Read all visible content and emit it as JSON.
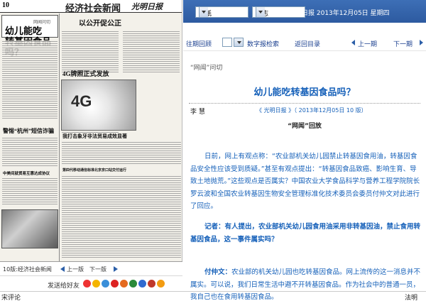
{
  "newspaper": {
    "page_number": "10",
    "section_title": "经济社会新闻",
    "masthead": "光明日报",
    "column_tag": "网闻问切",
    "main_headline_line1": "幼儿能吃",
    "main_headline_line2": "转基因食品吗？",
    "headlines": [
      "以公开促公正",
      "4G牌照正式发放",
      "我打击象牙非法贸易成效显著",
      "警惕“杭州”短信诈骗",
      "中美间就贸易互惠达成协议",
      "第四代移动通信标准北京京口站交付运行"
    ],
    "photo_label": "4G"
  },
  "paper_nav": {
    "label": "10版:经济社会新闻",
    "prev": "上一版",
    "next": "下一版"
  },
  "share": {
    "label": "发送给好友",
    "icons": [
      "sina-weibo-icon",
      "qq-space-icon",
      "tencent-weibo-icon",
      "renren-icon",
      "kaixin-icon",
      "douban-icon",
      "baidu-icon",
      "netease-icon",
      "plus-icon"
    ]
  },
  "bottom_strip": {
    "left": "宋评论",
    "right": "法明"
  },
  "top_bar": {
    "select1": "报纸",
    "select2": "杂志",
    "date": "光明日报  2013年12月05日 星期四"
  },
  "toolbar": {
    "back_label": "往期回顾",
    "page_select": "",
    "search_label": "数字报检索",
    "home_label": "返回目录",
    "prev_label": "上一期",
    "next_label": "下一期"
  },
  "article": {
    "kicker": "“网闻”问切",
    "title": "幼儿能吃转基因食品吗？",
    "author": "李  慧",
    "byline": "《 光明日报 》（ 2013年12月05日    10  版）",
    "column_title": "“网闻”回放",
    "para1": "日前，网上有观点称：“农业部机关幼儿园禁止转基因食用油，转基因食品安全性应该受到质疑。”甚至有观点提出：“转基因食品致癌、影响生育、导致土地抛荒。”这些观点是否属实？中国农业大学食品科学与营养工程学院院长罗云波和全国农业转基因生物安全管理标准化技术委员会委员付仲文对此进行了回应。",
    "para2_label": "记者：",
    "para2": "有人提出，农业部机关幼儿园食用油采用非转基因油，禁止食用转基因食品，这一事件属实吗？",
    "para3_label": "付仲文：",
    "para3": "农业部的机关幼儿园也吃转基因食品。网上流传的这一消息并不属实。可以说，我们日常生活中避不开转基因食品。作为社会中的普通一员，我自己也在食用转基因食品。"
  }
}
